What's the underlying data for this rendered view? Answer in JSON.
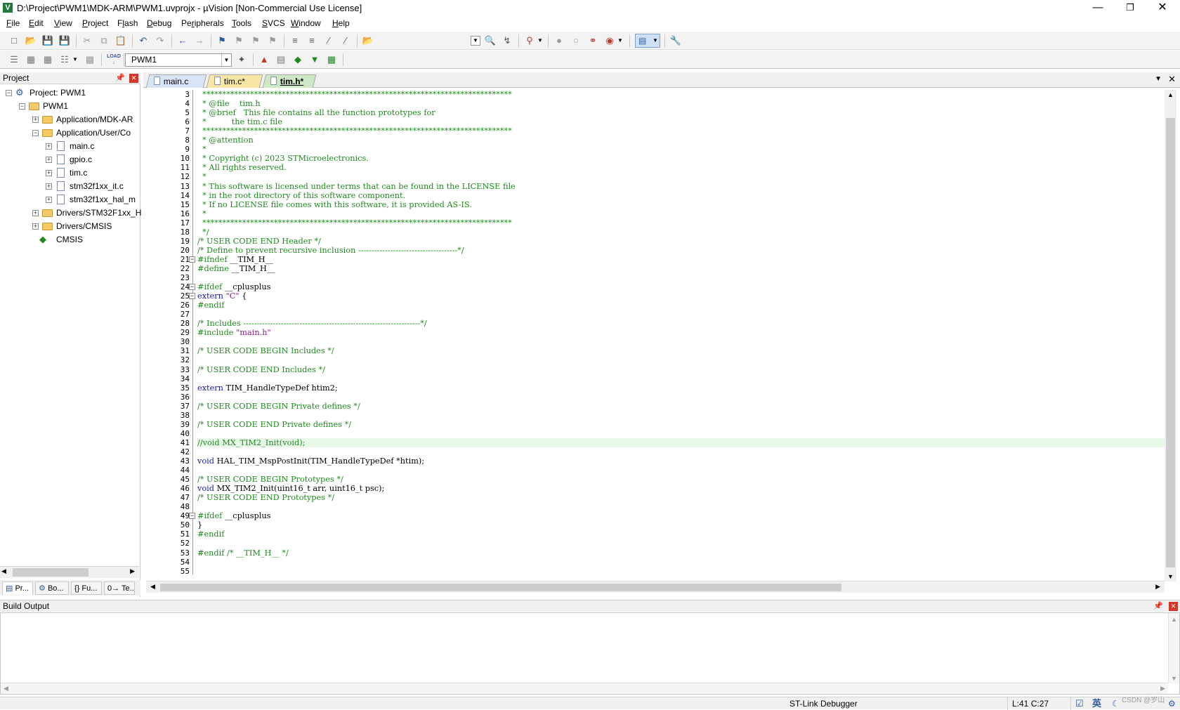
{
  "window": {
    "title": "D:\\Project\\PWM1\\MDK-ARM\\PWM1.uvprojx - µVision  [Non-Commercial Use License]",
    "controls": [
      "minimize",
      "restore",
      "close"
    ]
  },
  "menubar": {
    "items": [
      {
        "label": "File",
        "u": "F",
        "rest": "ile"
      },
      {
        "label": "Edit",
        "u": "E",
        "rest": "dit"
      },
      {
        "label": "View",
        "u": "V",
        "rest": "iew"
      },
      {
        "label": "Project",
        "u": "P",
        "rest": "roject"
      },
      {
        "label": "Flash",
        "u": "F",
        "rest": "lash",
        "pre": "F",
        "u2": "l",
        "rest2": "ash"
      },
      {
        "label": "Debug",
        "u": "D",
        "rest": "ebug"
      },
      {
        "label": "Peripherals",
        "pre": "Pe",
        "u": "r",
        "rest": "ipherals"
      },
      {
        "label": "Tools",
        "u": "T",
        "rest": "ools"
      },
      {
        "label": "SVCS",
        "u": "S",
        "rest": "VCS"
      },
      {
        "label": "Window",
        "u": "W",
        "rest": "indow"
      },
      {
        "label": "Help",
        "u": "H",
        "rest": "elp"
      }
    ]
  },
  "toolbar2": {
    "target": "PWM1",
    "load_label": "LOAD"
  },
  "project_panel": {
    "title": "Project",
    "tree": [
      {
        "label": "Project: PWM1",
        "level": 0,
        "type": "project",
        "expanded": true
      },
      {
        "label": "PWM1",
        "level": 1,
        "type": "target",
        "expanded": true
      },
      {
        "label": "Application/MDK-AR",
        "level": 2,
        "type": "folder",
        "expanded": false
      },
      {
        "label": "Application/User/Co",
        "level": 2,
        "type": "folder",
        "expanded": true
      },
      {
        "label": "main.c",
        "level": 3,
        "type": "file"
      },
      {
        "label": "gpio.c",
        "level": 3,
        "type": "file"
      },
      {
        "label": "tim.c",
        "level": 3,
        "type": "file"
      },
      {
        "label": "stm32f1xx_it.c",
        "level": 3,
        "type": "file"
      },
      {
        "label": "stm32f1xx_hal_m",
        "level": 3,
        "type": "file"
      },
      {
        "label": "Drivers/STM32F1xx_H",
        "level": 2,
        "type": "folder",
        "expanded": false
      },
      {
        "label": "Drivers/CMSIS",
        "level": 2,
        "type": "folder",
        "expanded": false
      },
      {
        "label": "CMSIS",
        "level": 2,
        "type": "component"
      }
    ],
    "bottom_tabs": [
      {
        "label": "Pr..."
      },
      {
        "label": "Bo..."
      },
      {
        "label": "{} Fu..."
      },
      {
        "label": "0→ Te..."
      }
    ]
  },
  "editor": {
    "tabs": [
      {
        "label": "main.c",
        "active": false,
        "color": "#d9e5f5"
      },
      {
        "label": "tim.c*",
        "active": false,
        "color": "#f7e6a6"
      },
      {
        "label": "tim.h*",
        "active": true,
        "color": "#cfe9c4"
      }
    ],
    "current_line": 41,
    "lines": [
      {
        "n": 3,
        "t": "  ******************************************************************************",
        "c": "cm"
      },
      {
        "n": 4,
        "t": "  * @file    tim.h",
        "c": "cm"
      },
      {
        "n": 5,
        "t": "  * @brief   This file contains all the function prototypes for",
        "c": "cm"
      },
      {
        "n": 6,
        "t": "  *          the tim.c file",
        "c": "cm"
      },
      {
        "n": 7,
        "t": "  ******************************************************************************",
        "c": "cm"
      },
      {
        "n": 8,
        "t": "  * @attention",
        "c": "cm"
      },
      {
        "n": 9,
        "t": "  *",
        "c": "cm"
      },
      {
        "n": 10,
        "t": "  * Copyright (c) 2023 STMicroelectronics.",
        "c": "cm"
      },
      {
        "n": 11,
        "t": "  * All rights reserved.",
        "c": "cm"
      },
      {
        "n": 12,
        "t": "  *",
        "c": "cm"
      },
      {
        "n": 13,
        "t": "  * This software is licensed under terms that can be found in the LICENSE file",
        "c": "cm"
      },
      {
        "n": 14,
        "t": "  * in the root directory of this software component.",
        "c": "cm"
      },
      {
        "n": 15,
        "t": "  * If no LICENSE file comes with this software, it is provided AS-IS.",
        "c": "cm"
      },
      {
        "n": 16,
        "t": "  *",
        "c": "cm"
      },
      {
        "n": 17,
        "t": "  ******************************************************************************",
        "c": "cm"
      },
      {
        "n": 18,
        "t": "  */",
        "c": "cm"
      },
      {
        "n": 19,
        "t": "/* USER CODE END Header */",
        "c": "cm"
      },
      {
        "n": 20,
        "t": "/* Define to prevent recursive inclusion -------------------------------------*/",
        "c": "cm"
      },
      {
        "n": 21,
        "t": "#ifndef __TIM_H__",
        "c": "pp",
        "fold": true
      },
      {
        "n": 22,
        "t": "#define __TIM_H__",
        "c": "pp"
      },
      {
        "n": 23,
        "t": "",
        "c": "ntx"
      },
      {
        "n": 24,
        "t": "#ifdef __cplusplus",
        "c": "pp",
        "fold": true
      },
      {
        "n": 25,
        "t": "extern \"C\" {",
        "c": "kw",
        "fold": true
      },
      {
        "n": 26,
        "t": "#endif",
        "c": "pp"
      },
      {
        "n": 27,
        "t": "",
        "c": "ntx"
      },
      {
        "n": 28,
        "t": "/* Includes ------------------------------------------------------------------*/",
        "c": "cm"
      },
      {
        "n": 29,
        "t": "#include \"main.h\"",
        "c": "pp"
      },
      {
        "n": 30,
        "t": "",
        "c": "ntx"
      },
      {
        "n": 31,
        "t": "/* USER CODE BEGIN Includes */",
        "c": "cm"
      },
      {
        "n": 32,
        "t": "",
        "c": "ntx"
      },
      {
        "n": 33,
        "t": "/* USER CODE END Includes */",
        "c": "cm"
      },
      {
        "n": 34,
        "t": "",
        "c": "ntx"
      },
      {
        "n": 35,
        "t": "extern TIM_HandleTypeDef htim2;",
        "c": "ext"
      },
      {
        "n": 36,
        "t": "",
        "c": "ntx"
      },
      {
        "n": 37,
        "t": "/* USER CODE BEGIN Private defines */",
        "c": "cm"
      },
      {
        "n": 38,
        "t": "",
        "c": "ntx"
      },
      {
        "n": 39,
        "t": "/* USER CODE END Private defines */",
        "c": "cm"
      },
      {
        "n": 40,
        "t": "",
        "c": "ntx"
      },
      {
        "n": 41,
        "t": "//void MX_TIM2_Init(void);",
        "c": "cm"
      },
      {
        "n": 42,
        "t": "",
        "c": "ntx"
      },
      {
        "n": 43,
        "t": "void HAL_TIM_MspPostInit(TIM_HandleTypeDef *htim);",
        "c": "fn"
      },
      {
        "n": 44,
        "t": "",
        "c": "ntx"
      },
      {
        "n": 45,
        "t": "/* USER CODE BEGIN Prototypes */",
        "c": "cm"
      },
      {
        "n": 46,
        "t": "void MX_TIM2_Init(uint16_t arr, uint16_t psc);",
        "c": "fn"
      },
      {
        "n": 47,
        "t": "/* USER CODE END Prototypes */",
        "c": "cm"
      },
      {
        "n": 48,
        "t": "",
        "c": "ntx"
      },
      {
        "n": 49,
        "t": "#ifdef __cplusplus",
        "c": "pp",
        "fold": true
      },
      {
        "n": 50,
        "t": "}",
        "c": "ntx"
      },
      {
        "n": 51,
        "t": "#endif",
        "c": "pp"
      },
      {
        "n": 52,
        "t": "",
        "c": "ntx"
      },
      {
        "n": 53,
        "t": "#endif /* __TIM_H__ */",
        "c": "pp"
      },
      {
        "n": 54,
        "t": "",
        "c": "ntx"
      },
      {
        "n": 55,
        "t": "",
        "c": "ntx"
      }
    ]
  },
  "build_output": {
    "title": "Build Output"
  },
  "statusbar": {
    "debugger": "ST-Link Debugger",
    "position": "L:41 C:27",
    "ime": "英",
    "watermark": "CSDN @岁山"
  }
}
